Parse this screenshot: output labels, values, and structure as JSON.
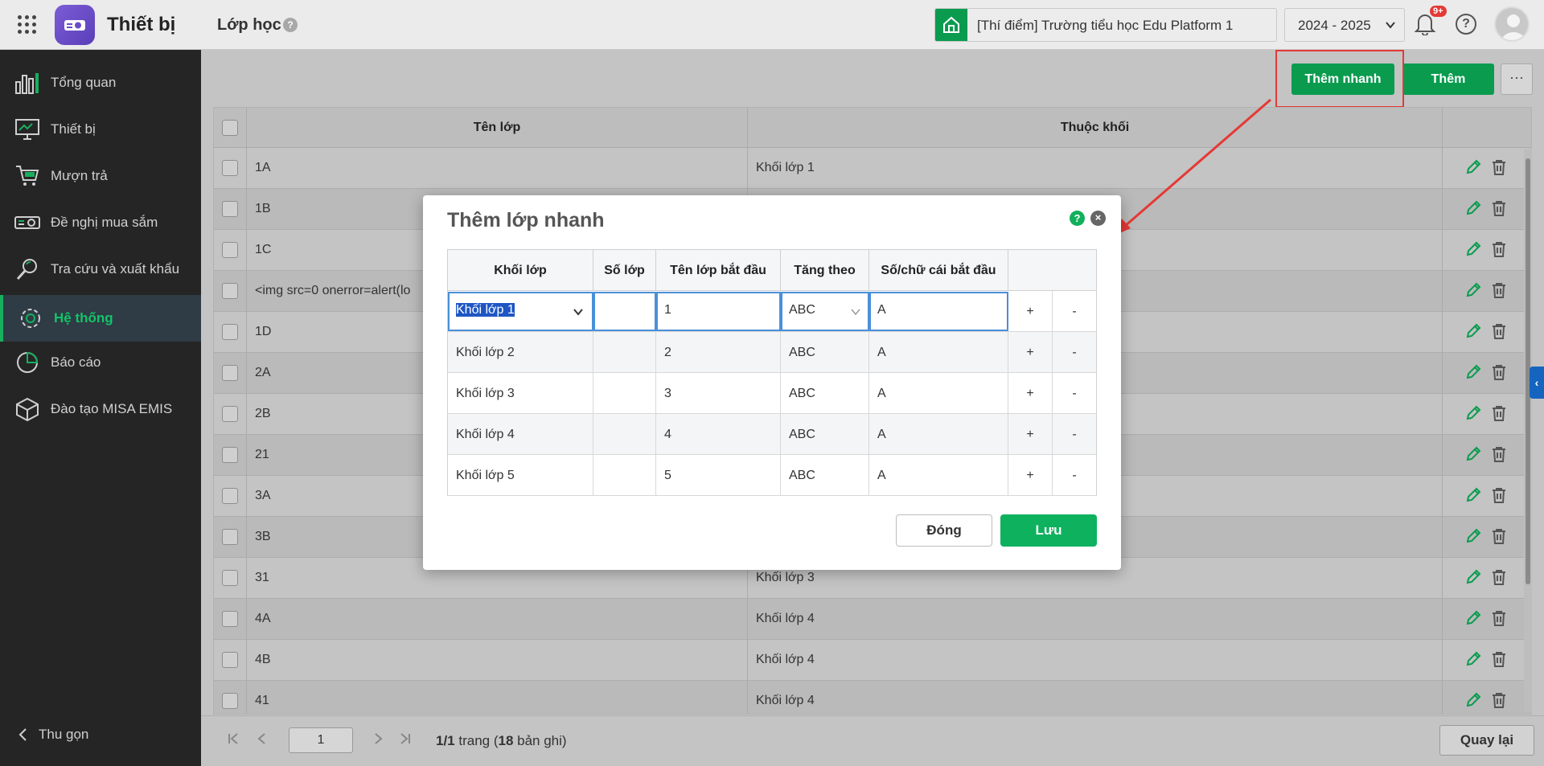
{
  "header": {
    "app_name": "Thiết bị",
    "page_title": "Lớp học",
    "page_help": "?",
    "school": "[Thí điểm] Trường tiểu học Edu Platform 1",
    "year": "2024 - 2025",
    "notification_badge": "9+",
    "help": "?"
  },
  "sidebar": {
    "items": [
      {
        "label": "Tổng quan",
        "icon": "bar-chart-icon"
      },
      {
        "label": "Thiết bị",
        "icon": "monitor-icon"
      },
      {
        "label": "Mượn trả",
        "icon": "cart-icon"
      },
      {
        "label": "Đề nghị mua sắm",
        "icon": "projector-icon"
      },
      {
        "label": "Tra cứu và xuất khẩu",
        "icon": "search-icon"
      },
      {
        "label": "Hệ thống",
        "icon": "gear-icon",
        "active": true
      },
      {
        "label": "Báo cáo",
        "icon": "pie-chart-icon"
      },
      {
        "label": "Đào tạo MISA EMIS",
        "icon": "cube-icon"
      }
    ],
    "collapse_label": "Thu gọn"
  },
  "toolbar": {
    "quick_add_label": "Thêm nhanh",
    "add_label": "Thêm",
    "more_label": "···"
  },
  "grid": {
    "columns": [
      "Tên lớp",
      "Thuộc khối"
    ],
    "rows": [
      {
        "name": "1A",
        "grade": "Khối lớp 1"
      },
      {
        "name": "1B",
        "grade": ""
      },
      {
        "name": "1C",
        "grade": ""
      },
      {
        "name": "<img src=0 onerror=alert(lo",
        "grade": ""
      },
      {
        "name": "1D",
        "grade": ""
      },
      {
        "name": "2A",
        "grade": ""
      },
      {
        "name": "2B",
        "grade": ""
      },
      {
        "name": "21",
        "grade": ""
      },
      {
        "name": "3A",
        "grade": ""
      },
      {
        "name": "3B",
        "grade": ""
      },
      {
        "name": "31",
        "grade": "Khối lớp 3"
      },
      {
        "name": "4A",
        "grade": "Khối lớp 4"
      },
      {
        "name": "4B",
        "grade": "Khối lớp 4"
      },
      {
        "name": "41",
        "grade": "Khối lớp 4"
      }
    ]
  },
  "pager": {
    "page_value": "1",
    "page_current": "1/1",
    "page_word": " trang (",
    "record_count": "18",
    "record_word": " bản ghi)",
    "back_label": "Quay lại"
  },
  "dialog": {
    "title": "Thêm lớp nhanh",
    "help": "?",
    "close": "×",
    "columns": [
      "Khối lớp",
      "Số lớp",
      "Tên lớp bắt đầu",
      "Tăng theo",
      "Số/chữ cái bắt đầu"
    ],
    "rows": [
      {
        "grade": "Khối lớp 1",
        "count": "",
        "start_name": "1",
        "increment": "ABC",
        "start_char": "A"
      },
      {
        "grade": "Khối lớp 2",
        "count": "",
        "start_name": "2",
        "increment": "ABC",
        "start_char": "A"
      },
      {
        "grade": "Khối lớp 3",
        "count": "",
        "start_name": "3",
        "increment": "ABC",
        "start_char": "A"
      },
      {
        "grade": "Khối lớp 4",
        "count": "",
        "start_name": "4",
        "increment": "ABC",
        "start_char": "A"
      },
      {
        "grade": "Khối lớp 5",
        "count": "",
        "start_name": "5",
        "increment": "ABC",
        "start_char": "A"
      }
    ],
    "plus": "+",
    "minus": "-",
    "close_label": "Đóng",
    "save_label": "Lưu"
  },
  "colors": {
    "accent": "#0a9b4f",
    "save": "#0eb15e",
    "highlight": "#e53935",
    "sidebar_bg": "#252525",
    "active_text": "#12c468"
  }
}
